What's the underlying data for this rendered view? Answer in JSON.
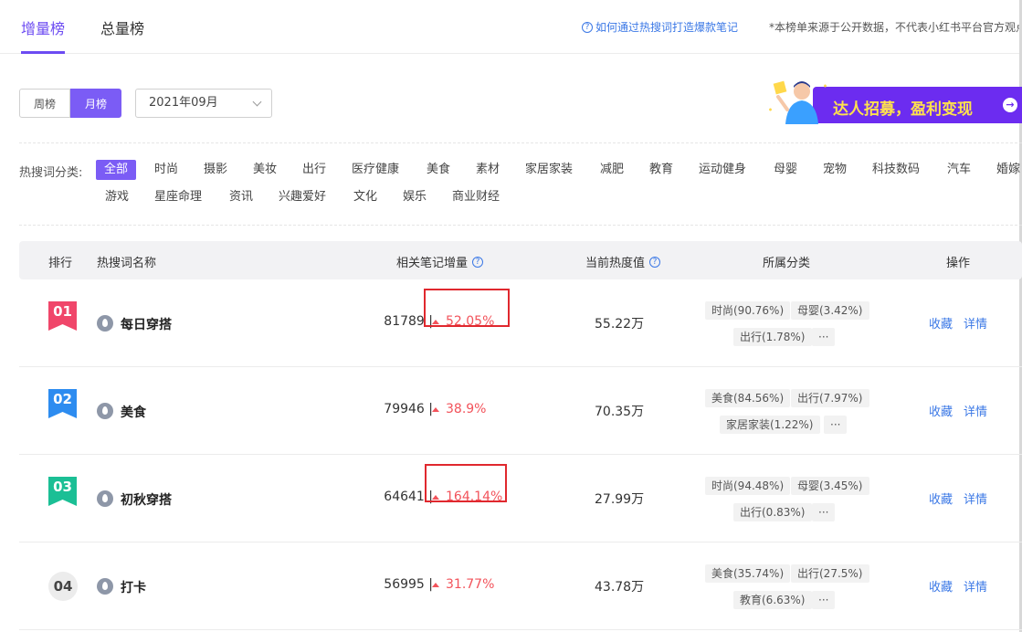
{
  "tabs": [
    {
      "label": "增量榜",
      "active": true
    },
    {
      "label": "总量榜",
      "active": false
    }
  ],
  "help_link": "如何通过热搜词打造爆款笔记",
  "disclaimer": "*本榜单来源于公开数据，不代表小红书平台官方观点",
  "period": {
    "options": [
      "周榜",
      "月榜"
    ],
    "selected": "月榜",
    "month": "2021年09月"
  },
  "banner": {
    "text": "达人招募，盈利变现"
  },
  "category_filter": {
    "label": "热搜词分类:",
    "row1": [
      "全部",
      "时尚",
      "摄影",
      "美妆",
      "出行",
      "医疗健康",
      "美食",
      "素材",
      "家居家装",
      "减肥",
      "教育",
      "运动健身",
      "母婴",
      "宠物",
      "科技数码",
      "汽车",
      "婚嫁"
    ],
    "row2": [
      "游戏",
      "星座命理",
      "资讯",
      "兴趣爱好",
      "文化",
      "娱乐",
      "商业财经"
    ],
    "selected": "全部"
  },
  "table": {
    "headers": {
      "rank": "排行",
      "name": "热搜词名称",
      "notes_growth": "相关笔记增量",
      "heat": "当前热度值",
      "category": "所属分类",
      "action": "操作"
    },
    "actions": {
      "favorite": "收藏",
      "detail": "详情"
    },
    "more_tag": "···",
    "rows": [
      {
        "rank": "01",
        "keyword": "每日穿搭",
        "notes": "81789 |",
        "growth": "52.05%",
        "heat": "55.22万",
        "tags": [
          "时尚(90.76%)",
          "母婴(3.42%)",
          "出行(1.78%)"
        ],
        "highlighted": true,
        "rank_color": "#f0466a"
      },
      {
        "rank": "02",
        "keyword": "美食",
        "notes": "79946 |",
        "growth": "38.9%",
        "heat": "70.35万",
        "tags": [
          "美食(84.56%)",
          "出行(7.97%)",
          "家居家装(1.22%)"
        ],
        "highlighted": false,
        "rank_color": "#2d8cf0"
      },
      {
        "rank": "03",
        "keyword": "初秋穿搭",
        "notes": "64641 |",
        "growth": "164.14%",
        "heat": "27.99万",
        "tags": [
          "时尚(94.48%)",
          "母婴(3.45%)",
          "出行(0.83%)"
        ],
        "highlighted": true,
        "rank_color": "#1bbf95"
      },
      {
        "rank": "04",
        "keyword": "打卡",
        "notes": "56995 |",
        "growth": "31.77%",
        "heat": "43.78万",
        "tags": [
          "美食(35.74%)",
          "出行(27.5%)",
          "教育(6.63%)"
        ],
        "highlighted": false,
        "rank_color": "#ececec"
      }
    ]
  },
  "colors": {
    "accent": "#7b5cf5",
    "link": "#3b78e6",
    "growth_up": "#f2535b",
    "highlight_box": "#e0282e"
  }
}
